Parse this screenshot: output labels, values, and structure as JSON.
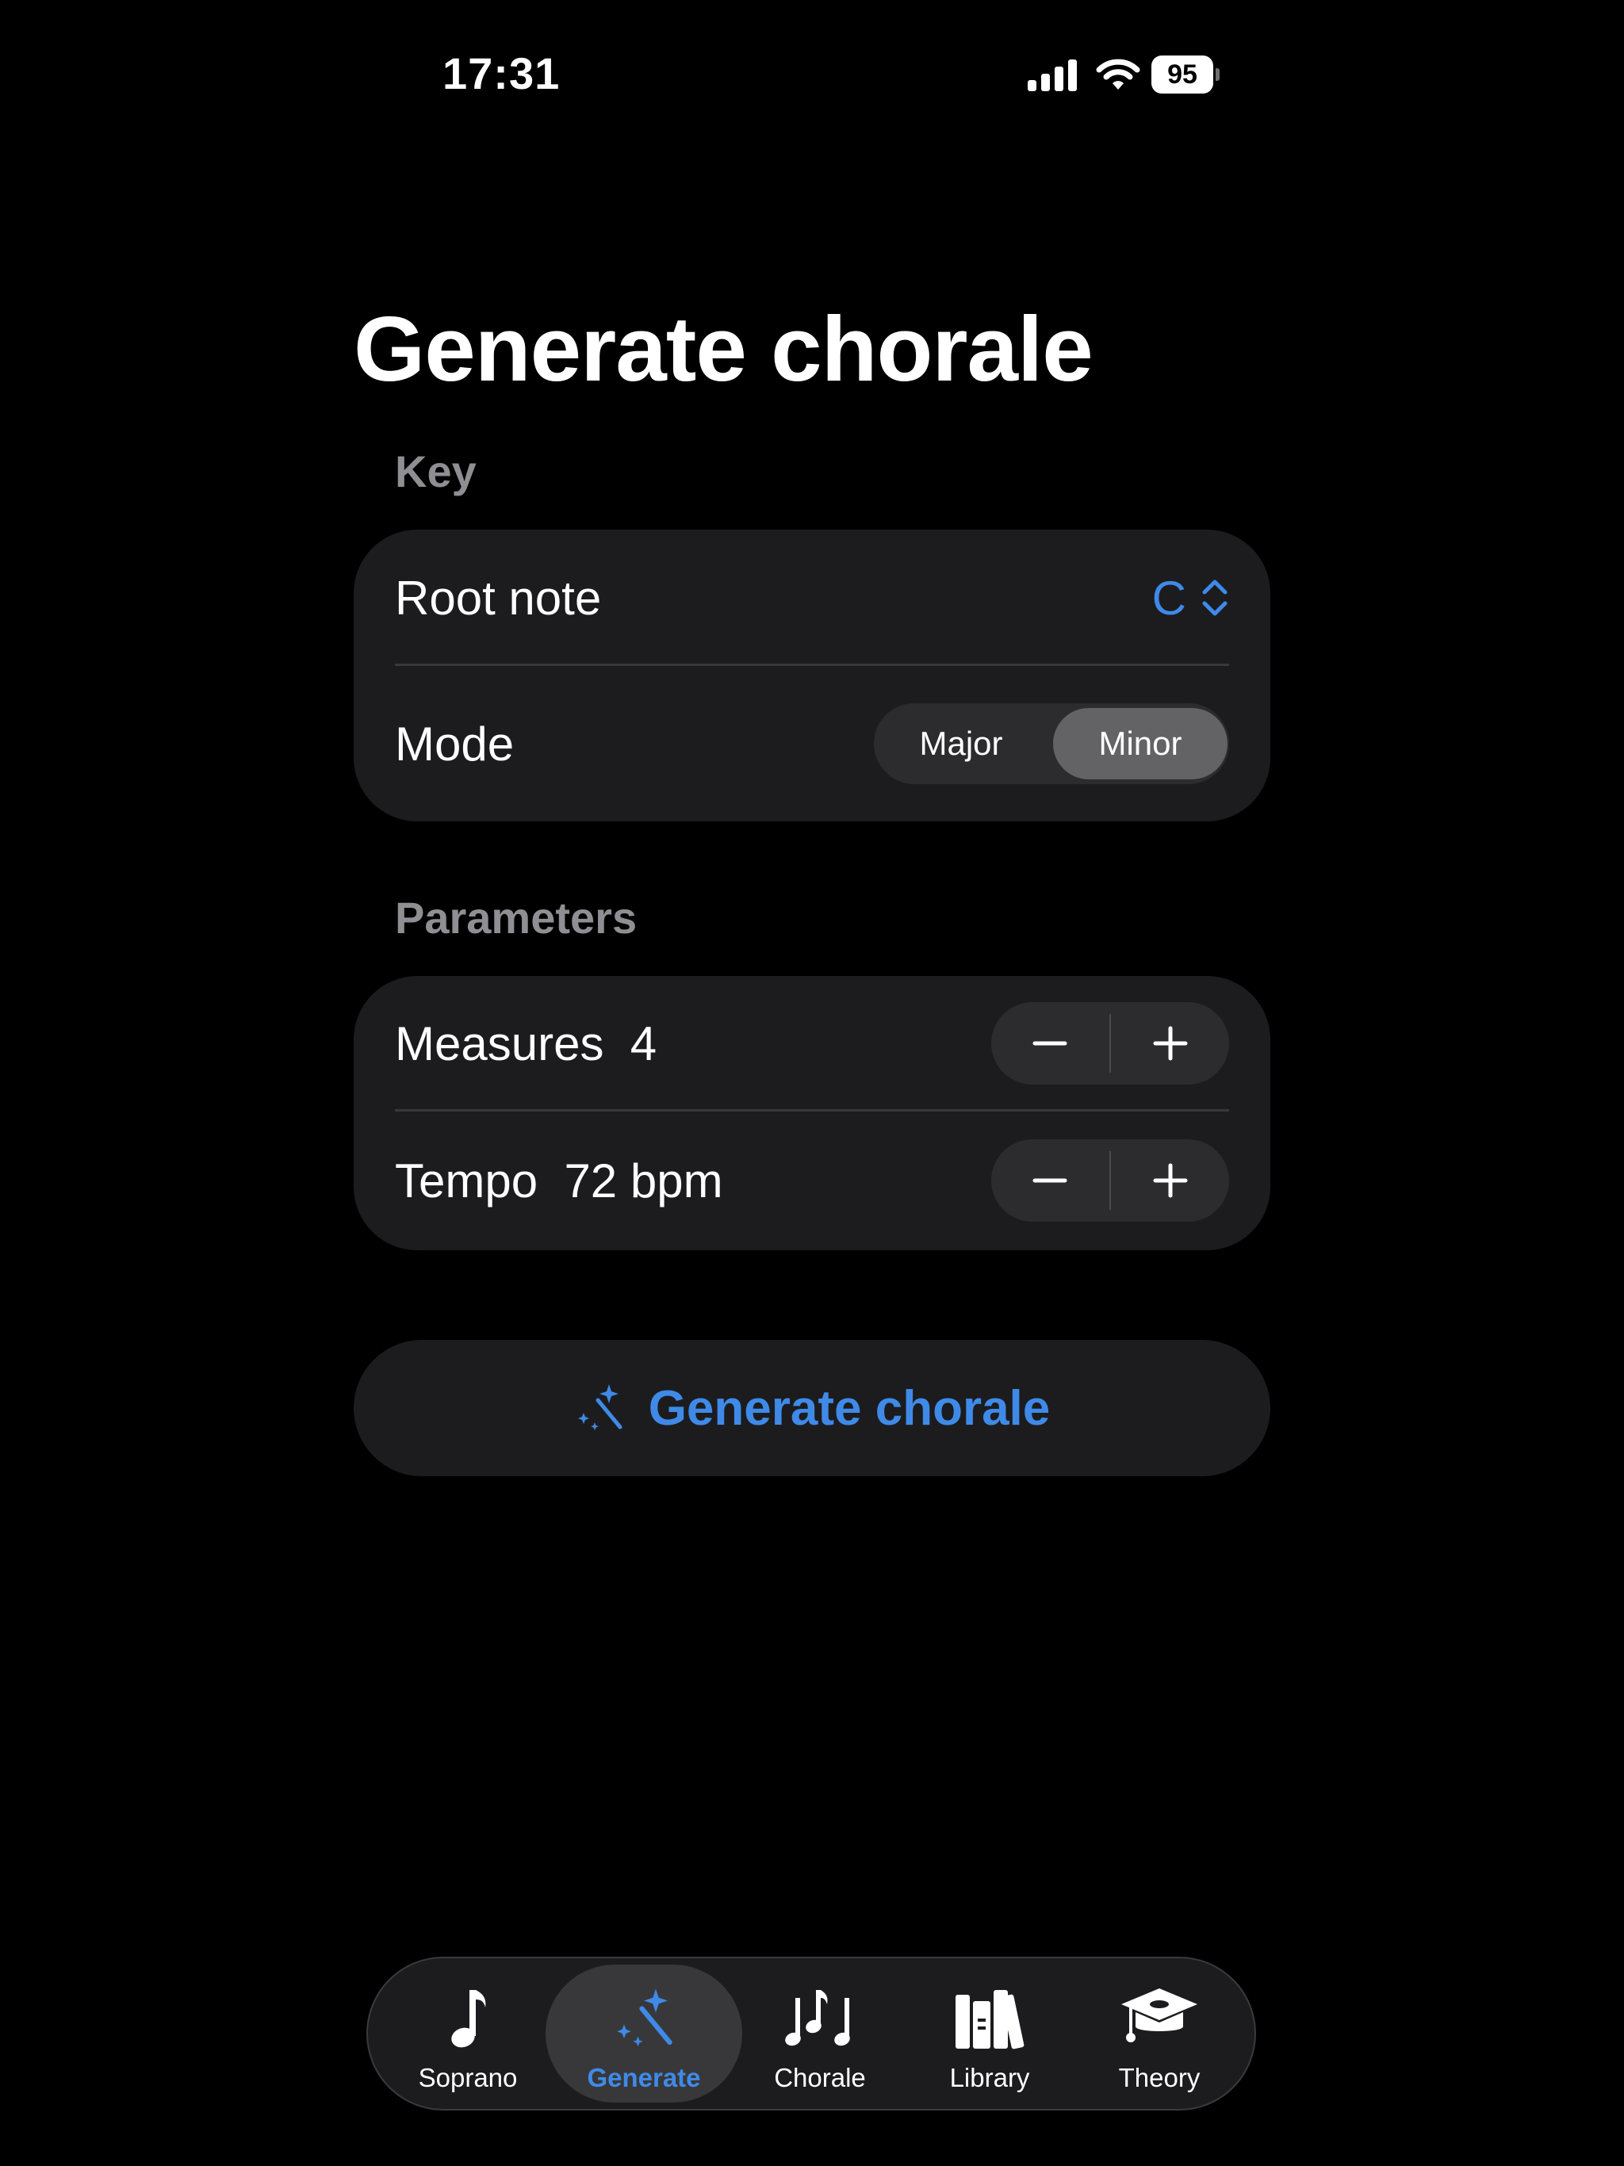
{
  "status_bar": {
    "time": "17:31",
    "battery_percent": "95"
  },
  "title": "Generate chorale",
  "key_section": {
    "header": "Key",
    "root_note_label": "Root note",
    "root_note_value": "C",
    "mode_label": "Mode",
    "mode_options": [
      "Major",
      "Minor"
    ],
    "mode_selected": "Minor"
  },
  "parameters_section": {
    "header": "Parameters",
    "measures_label": "Measures",
    "measures_value": "4",
    "tempo_label": "Tempo",
    "tempo_value": "72 bpm"
  },
  "generate_button": {
    "label": "Generate chorale",
    "icon": "magic-wand-icon"
  },
  "tabs": [
    {
      "label": "Soprano",
      "icon": "music-note-icon"
    },
    {
      "label": "Generate",
      "icon": "magic-wand-icon",
      "active": true
    },
    {
      "label": "Chorale",
      "icon": "music-notes-icon"
    },
    {
      "label": "Library",
      "icon": "books-icon"
    },
    {
      "label": "Theory",
      "icon": "graduation-cap-icon"
    }
  ],
  "colors": {
    "accent": "#3f8ae8",
    "card": "#1c1c1e",
    "background": "#000000",
    "secondary_text": "#8e8e93"
  }
}
